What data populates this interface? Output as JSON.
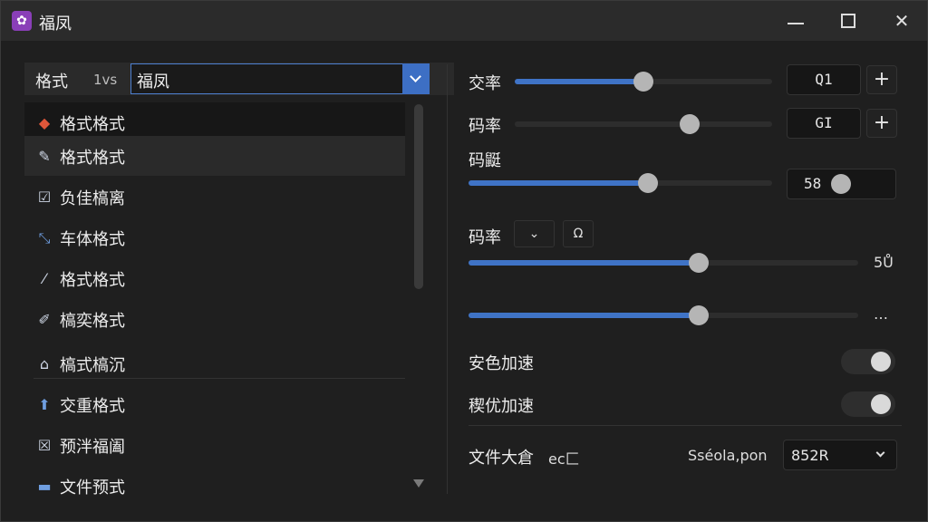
{
  "window": {
    "title": "福凤",
    "app_icon": "app-logo-icon"
  },
  "format": {
    "label": "格式",
    "version": "1vs",
    "value": "福凤"
  },
  "list": [
    {
      "icon": "◆",
      "label": "格式格式"
    },
    {
      "icon": "✎",
      "label": "格式格式"
    },
    {
      "icon": "☑",
      "label": "负佳槁离"
    },
    {
      "icon": "⤡",
      "label": "车体格式"
    },
    {
      "icon": "⁄",
      "label": "格式格式"
    },
    {
      "icon": "✐",
      "label": "槁奕格式"
    },
    {
      "icon": "⌂",
      "label": "槁式槁沉"
    },
    {
      "icon": "⬆",
      "label": "交重格式"
    },
    {
      "icon": "☒",
      "label": "预泮福阖"
    },
    {
      "icon": "▬",
      "label": "文件预式"
    }
  ],
  "controls": {
    "row1": {
      "label": "交率",
      "value": "Q1",
      "level": 0.5
    },
    "row2": {
      "label": "码率",
      "value": "GI",
      "level": 0.68
    },
    "row3": {
      "label": "码鼮",
      "value": "58",
      "level": 0.59
    },
    "row4": {
      "label": "码率",
      "btn_a": "⌄",
      "btn_b": "Ω",
      "value": "5Ů",
      "level": 0.59
    },
    "row5": {
      "value": "…",
      "level": 0.59
    },
    "toggle1": {
      "label": "安色加速",
      "on": true
    },
    "toggle2": {
      "label": "稧优加速",
      "on": true
    },
    "file": {
      "label": "文件大倉",
      "ext": "ec匚",
      "text": "Sséola,pon",
      "select": "852R"
    }
  }
}
